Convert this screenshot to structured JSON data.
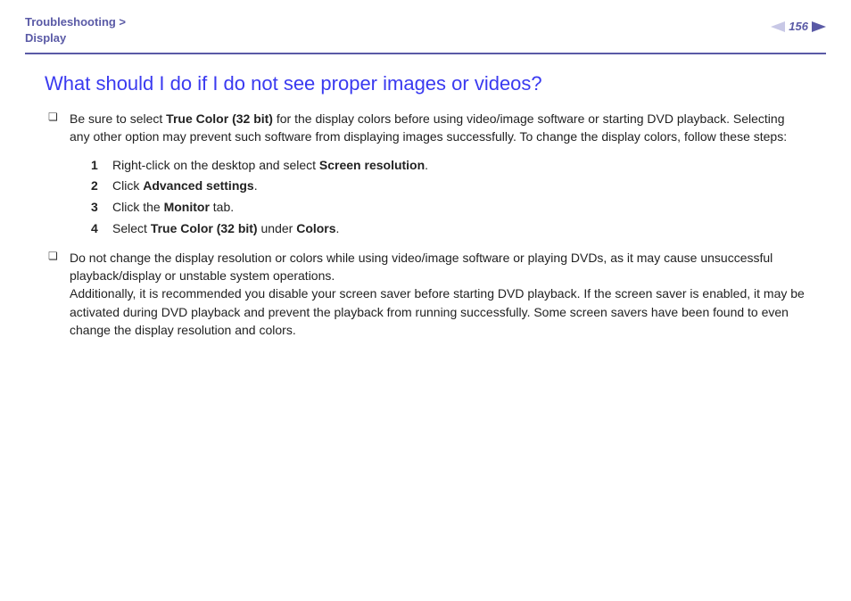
{
  "breadcrumb": {
    "line1": "Troubleshooting >",
    "line2": "Display"
  },
  "page_number": "156",
  "title": "What should I do if I do not see proper images or videos?",
  "bullet1": {
    "pre": "Be sure to select ",
    "b1": "True Color (32 bit)",
    "post": " for the display colors before using video/image software or starting DVD playback. Selecting any other option may prevent such software from displaying images successfully. To change the display colors, follow these steps:"
  },
  "steps": {
    "s1": {
      "n": "1",
      "pre": "Right-click on the desktop and select ",
      "b": "Screen resolution",
      "post": "."
    },
    "s2": {
      "n": "2",
      "pre": "Click ",
      "b": "Advanced settings",
      "post": "."
    },
    "s3": {
      "n": "3",
      "pre": "Click the ",
      "b": "Monitor",
      "post": " tab."
    },
    "s4": {
      "n": "4",
      "pre": "Select ",
      "b1": "True Color (32 bit)",
      "mid": " under ",
      "b2": "Colors",
      "post": "."
    }
  },
  "bullet2": {
    "p1": "Do not change the display resolution or colors while using video/image software or playing DVDs, as it may cause unsuccessful playback/display or unstable system operations.",
    "p2": "Additionally, it is recommended you disable your screen saver before starting DVD playback. If the screen saver is enabled, it may be activated during DVD playback and prevent the playback from running successfully. Some screen savers have been found to even change the display resolution and colors."
  }
}
